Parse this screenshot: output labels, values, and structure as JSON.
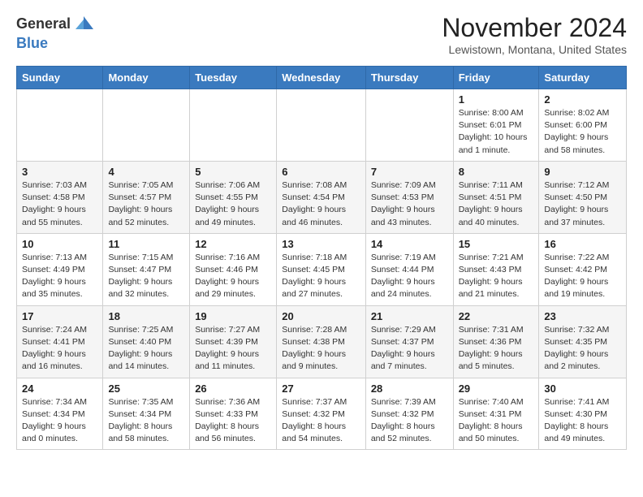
{
  "header": {
    "logo_line1": "General",
    "logo_line2": "Blue",
    "month": "November 2024",
    "location": "Lewistown, Montana, United States"
  },
  "days_of_week": [
    "Sunday",
    "Monday",
    "Tuesday",
    "Wednesday",
    "Thursday",
    "Friday",
    "Saturday"
  ],
  "weeks": [
    [
      {
        "day": "",
        "info": ""
      },
      {
        "day": "",
        "info": ""
      },
      {
        "day": "",
        "info": ""
      },
      {
        "day": "",
        "info": ""
      },
      {
        "day": "",
        "info": ""
      },
      {
        "day": "1",
        "info": "Sunrise: 8:00 AM\nSunset: 6:01 PM\nDaylight: 10 hours\nand 1 minute."
      },
      {
        "day": "2",
        "info": "Sunrise: 8:02 AM\nSunset: 6:00 PM\nDaylight: 9 hours\nand 58 minutes."
      }
    ],
    [
      {
        "day": "3",
        "info": "Sunrise: 7:03 AM\nSunset: 4:58 PM\nDaylight: 9 hours\nand 55 minutes."
      },
      {
        "day": "4",
        "info": "Sunrise: 7:05 AM\nSunset: 4:57 PM\nDaylight: 9 hours\nand 52 minutes."
      },
      {
        "day": "5",
        "info": "Sunrise: 7:06 AM\nSunset: 4:55 PM\nDaylight: 9 hours\nand 49 minutes."
      },
      {
        "day": "6",
        "info": "Sunrise: 7:08 AM\nSunset: 4:54 PM\nDaylight: 9 hours\nand 46 minutes."
      },
      {
        "day": "7",
        "info": "Sunrise: 7:09 AM\nSunset: 4:53 PM\nDaylight: 9 hours\nand 43 minutes."
      },
      {
        "day": "8",
        "info": "Sunrise: 7:11 AM\nSunset: 4:51 PM\nDaylight: 9 hours\nand 40 minutes."
      },
      {
        "day": "9",
        "info": "Sunrise: 7:12 AM\nSunset: 4:50 PM\nDaylight: 9 hours\nand 37 minutes."
      }
    ],
    [
      {
        "day": "10",
        "info": "Sunrise: 7:13 AM\nSunset: 4:49 PM\nDaylight: 9 hours\nand 35 minutes."
      },
      {
        "day": "11",
        "info": "Sunrise: 7:15 AM\nSunset: 4:47 PM\nDaylight: 9 hours\nand 32 minutes."
      },
      {
        "day": "12",
        "info": "Sunrise: 7:16 AM\nSunset: 4:46 PM\nDaylight: 9 hours\nand 29 minutes."
      },
      {
        "day": "13",
        "info": "Sunrise: 7:18 AM\nSunset: 4:45 PM\nDaylight: 9 hours\nand 27 minutes."
      },
      {
        "day": "14",
        "info": "Sunrise: 7:19 AM\nSunset: 4:44 PM\nDaylight: 9 hours\nand 24 minutes."
      },
      {
        "day": "15",
        "info": "Sunrise: 7:21 AM\nSunset: 4:43 PM\nDaylight: 9 hours\nand 21 minutes."
      },
      {
        "day": "16",
        "info": "Sunrise: 7:22 AM\nSunset: 4:42 PM\nDaylight: 9 hours\nand 19 minutes."
      }
    ],
    [
      {
        "day": "17",
        "info": "Sunrise: 7:24 AM\nSunset: 4:41 PM\nDaylight: 9 hours\nand 16 minutes."
      },
      {
        "day": "18",
        "info": "Sunrise: 7:25 AM\nSunset: 4:40 PM\nDaylight: 9 hours\nand 14 minutes."
      },
      {
        "day": "19",
        "info": "Sunrise: 7:27 AM\nSunset: 4:39 PM\nDaylight: 9 hours\nand 11 minutes."
      },
      {
        "day": "20",
        "info": "Sunrise: 7:28 AM\nSunset: 4:38 PM\nDaylight: 9 hours\nand 9 minutes."
      },
      {
        "day": "21",
        "info": "Sunrise: 7:29 AM\nSunset: 4:37 PM\nDaylight: 9 hours\nand 7 minutes."
      },
      {
        "day": "22",
        "info": "Sunrise: 7:31 AM\nSunset: 4:36 PM\nDaylight: 9 hours\nand 5 minutes."
      },
      {
        "day": "23",
        "info": "Sunrise: 7:32 AM\nSunset: 4:35 PM\nDaylight: 9 hours\nand 2 minutes."
      }
    ],
    [
      {
        "day": "24",
        "info": "Sunrise: 7:34 AM\nSunset: 4:34 PM\nDaylight: 9 hours\nand 0 minutes."
      },
      {
        "day": "25",
        "info": "Sunrise: 7:35 AM\nSunset: 4:34 PM\nDaylight: 8 hours\nand 58 minutes."
      },
      {
        "day": "26",
        "info": "Sunrise: 7:36 AM\nSunset: 4:33 PM\nDaylight: 8 hours\nand 56 minutes."
      },
      {
        "day": "27",
        "info": "Sunrise: 7:37 AM\nSunset: 4:32 PM\nDaylight: 8 hours\nand 54 minutes."
      },
      {
        "day": "28",
        "info": "Sunrise: 7:39 AM\nSunset: 4:32 PM\nDaylight: 8 hours\nand 52 minutes."
      },
      {
        "day": "29",
        "info": "Sunrise: 7:40 AM\nSunset: 4:31 PM\nDaylight: 8 hours\nand 50 minutes."
      },
      {
        "day": "30",
        "info": "Sunrise: 7:41 AM\nSunset: 4:30 PM\nDaylight: 8 hours\nand 49 minutes."
      }
    ]
  ]
}
